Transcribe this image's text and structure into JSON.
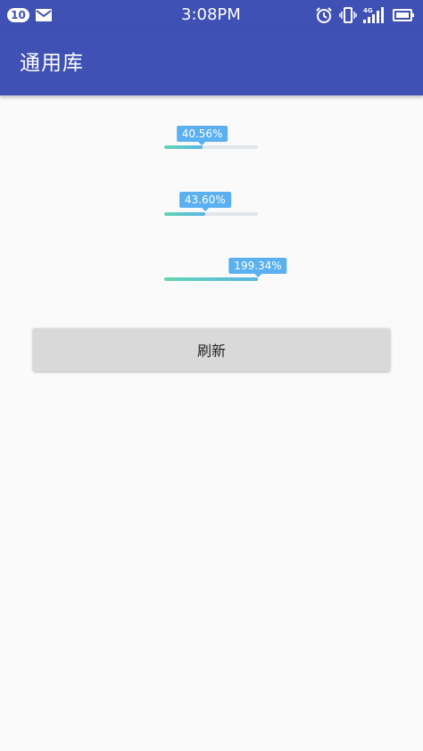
{
  "status_bar": {
    "notification_count": "10",
    "time": "3:08PM",
    "network_label": "4G",
    "icons": [
      "mail-icon",
      "alarm-icon",
      "vibrate-icon",
      "signal-icon",
      "battery-icon"
    ]
  },
  "app_bar": {
    "title": "通用库"
  },
  "progress_bars": [
    {
      "label": "40.56%",
      "value": 40.56
    },
    {
      "label": "43.60%",
      "value": 43.6
    },
    {
      "label": "199.34%",
      "value": 199.34
    }
  ],
  "refresh_button": {
    "label": "刷新"
  },
  "colors": {
    "primary": "#3f51b5",
    "tooltip": "#5ab0f0",
    "progress_start": "#62d6b0",
    "progress_end": "#5ab4ea",
    "track": "#e1e6ea"
  }
}
